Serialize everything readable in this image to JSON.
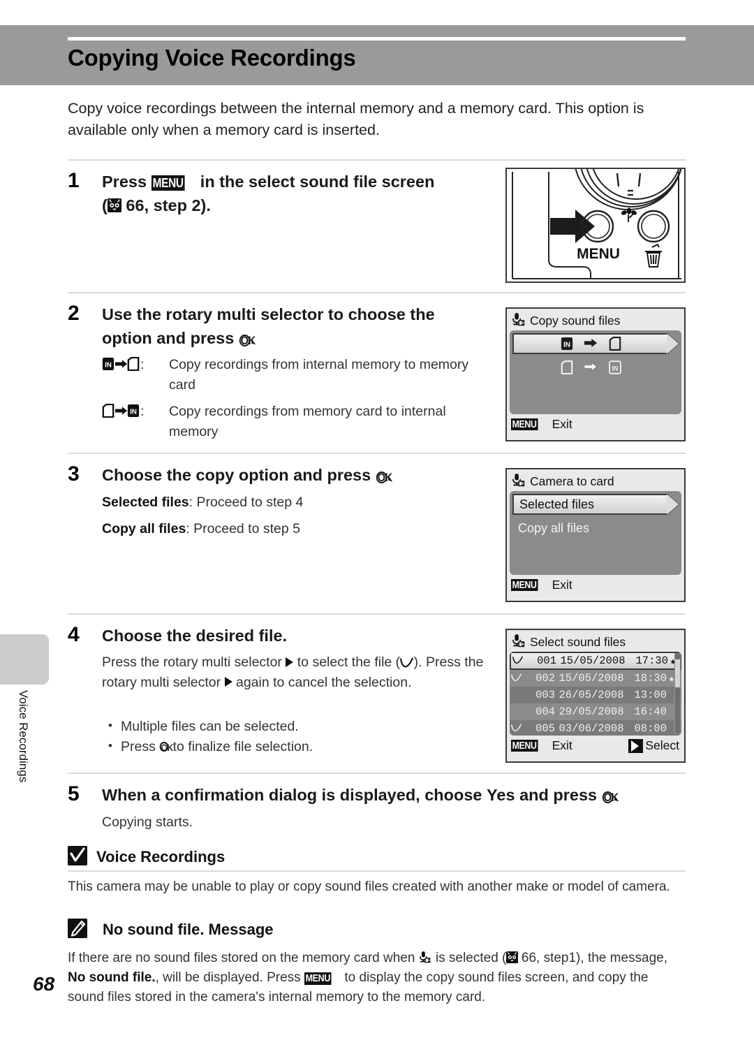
{
  "header": {
    "title": "Copying Voice Recordings"
  },
  "side_tab": {
    "label": "Voice Recordings"
  },
  "page_number": "68",
  "intro": "Copy voice recordings between the internal memory and a memory card. This option is available only when a memory card is inserted.",
  "steps": [
    {
      "number": "1",
      "heading_a": "Press ",
      "heading_menu": "MENU",
      "heading_b": " in the select sound file screen",
      "heading_c": " 66, step 2).",
      "heading_paren": "("
    },
    {
      "number": "2",
      "heading_a": "Use the rotary multi selector to choose the option and press ",
      "heading_ok": "OK",
      "heading_b": ".",
      "desc1_label_sep": ": ",
      "desc1": "Copy recordings from internal memory to memory card",
      "desc2": "Copy recordings from memory card to internal memory",
      "icon_in": "IN",
      "icon_card": "card"
    },
    {
      "number": "3",
      "heading_a": "Choose the copy option and press ",
      "heading_ok": "OK",
      "heading_b": ".",
      "opt1_bold": "Selected files",
      "opt1_rest": ":  Proceed to step 4",
      "opt2_bold": "Copy all files",
      "opt2_rest": ":  Proceed to step 5"
    },
    {
      "number": "4",
      "heading": "Choose the desired file.",
      "body1_a": "Press the rotary multi selector ",
      "body1_b": " to select the file (",
      "body1_c": ").",
      "body2_a": "Press the rotary multi selector ",
      "body2_b": " again to cancel the selection.",
      "bullet1": "Multiple files can be selected.",
      "bullet2_a": "Press ",
      "bullet2_ok": "OK",
      "bullet2_b": " to finalize file selection."
    },
    {
      "number": "5",
      "heading_a": "When a confirmation dialog is displayed, choose ",
      "heading_yes": "Yes",
      "heading_b": " and press ",
      "heading_ok": "OK",
      "heading_c": ".",
      "body": "Copying starts."
    }
  ],
  "screens": {
    "copy_sound_files": {
      "title": "Copy sound files",
      "option1": {
        "from": "IN",
        "to": "card"
      },
      "option2": {
        "from": "card",
        "to": "IN"
      },
      "footer_key": "MENU",
      "footer_label": "Exit"
    },
    "camera_to_card": {
      "title": "Camera to card",
      "items": [
        "Selected files",
        "Copy all files"
      ],
      "selected_index": 0,
      "footer_key": "MENU",
      "footer_label": "Exit"
    },
    "select_sound_files": {
      "title": "Select sound files",
      "files": [
        {
          "check": true,
          "no": "001",
          "date": "15/05/2008",
          "time": "17:30",
          "star": true,
          "selected": true,
          "alt": false
        },
        {
          "check": true,
          "no": "002",
          "date": "15/05/2008",
          "time": "18:30",
          "star": true,
          "selected": false,
          "alt": false
        },
        {
          "check": false,
          "no": "003",
          "date": "26/05/2008",
          "time": "13:00",
          "star": false,
          "selected": false,
          "alt": true
        },
        {
          "check": false,
          "no": "004",
          "date": "29/05/2008",
          "time": "16:40",
          "star": false,
          "selected": false,
          "alt": false
        },
        {
          "check": true,
          "no": "005",
          "date": "03/06/2008",
          "time": "08:00",
          "star": false,
          "selected": false,
          "alt": true
        }
      ],
      "footer_key": "MENU",
      "footer_label": "Exit",
      "footer_right_label": "Select"
    }
  },
  "camera_illustration": {
    "menu_label": "MENU",
    "macro_icon": "flower-icon",
    "delete_icon": "trash-icon"
  },
  "notes": [
    {
      "icon": "check-note-icon",
      "title": "Voice Recordings",
      "body": "This camera may be unable to play or copy sound files created with another make or model of camera."
    },
    {
      "icon": "pencil-note-icon",
      "title": "No sound file. Message",
      "body_a": "If there are no sound files stored on the memory card when ",
      "body_b": " is selected (",
      "body_c": " 66, step1), the message, ",
      "body_bold": "No sound file.",
      "body_d": ", will be displayed. Press ",
      "body_menu": "MENU",
      "body_e": " to display the copy sound files screen, and copy the sound files stored in the camera's internal memory to the memory card."
    }
  ],
  "colors": {
    "header_bg": "#9a9a9a",
    "lcd_panel": "#8b8b8b",
    "divider": "#d9d9d9",
    "side_tab": "#cccccc"
  }
}
